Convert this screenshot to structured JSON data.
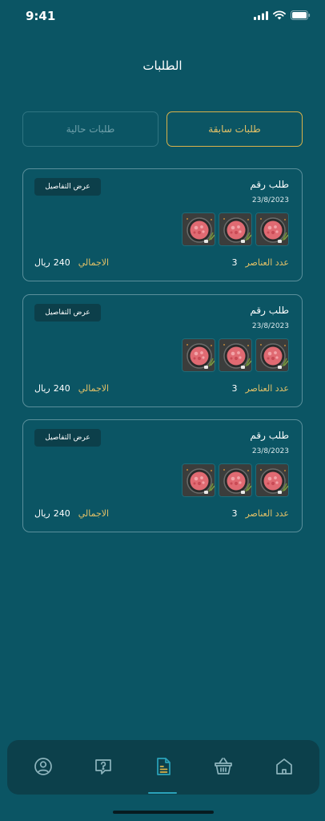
{
  "status_bar": {
    "time": "9:41"
  },
  "page": {
    "title": "الطلبات"
  },
  "tabs": {
    "current": "طلبات حالية",
    "previous": "طلبات سابقة",
    "active": "previous"
  },
  "orders": [
    {
      "title": "طلب رقم",
      "date": "23/8/2023",
      "details_label": "عرض التفاصيل",
      "items_label": "عدد العناصر",
      "items_count": "3",
      "total_label": "الاجمالي",
      "total_amount": "240",
      "currency": "ريال",
      "thumbnails": 3
    },
    {
      "title": "طلب رقم",
      "date": "23/8/2023",
      "details_label": "عرض التفاصيل",
      "items_label": "عدد العناصر",
      "items_count": "3",
      "total_label": "الاجمالي",
      "total_amount": "240",
      "currency": "ريال",
      "thumbnails": 3
    },
    {
      "title": "طلب رقم",
      "date": "23/8/2023",
      "details_label": "عرض التفاصيل",
      "items_label": "عدد العناصر",
      "items_count": "3",
      "total_label": "الاجمالي",
      "total_amount": "240",
      "currency": "ريال",
      "thumbnails": 3
    }
  ],
  "nav": {
    "items": [
      "profile-icon",
      "help-icon",
      "orders-icon",
      "basket-icon",
      "home-icon"
    ],
    "active": "orders-icon"
  },
  "colors": {
    "background": "#0b5564",
    "accent_gold": "#d9b24a",
    "nav_background": "#0c404b",
    "nav_active": "#2aa3bb"
  }
}
